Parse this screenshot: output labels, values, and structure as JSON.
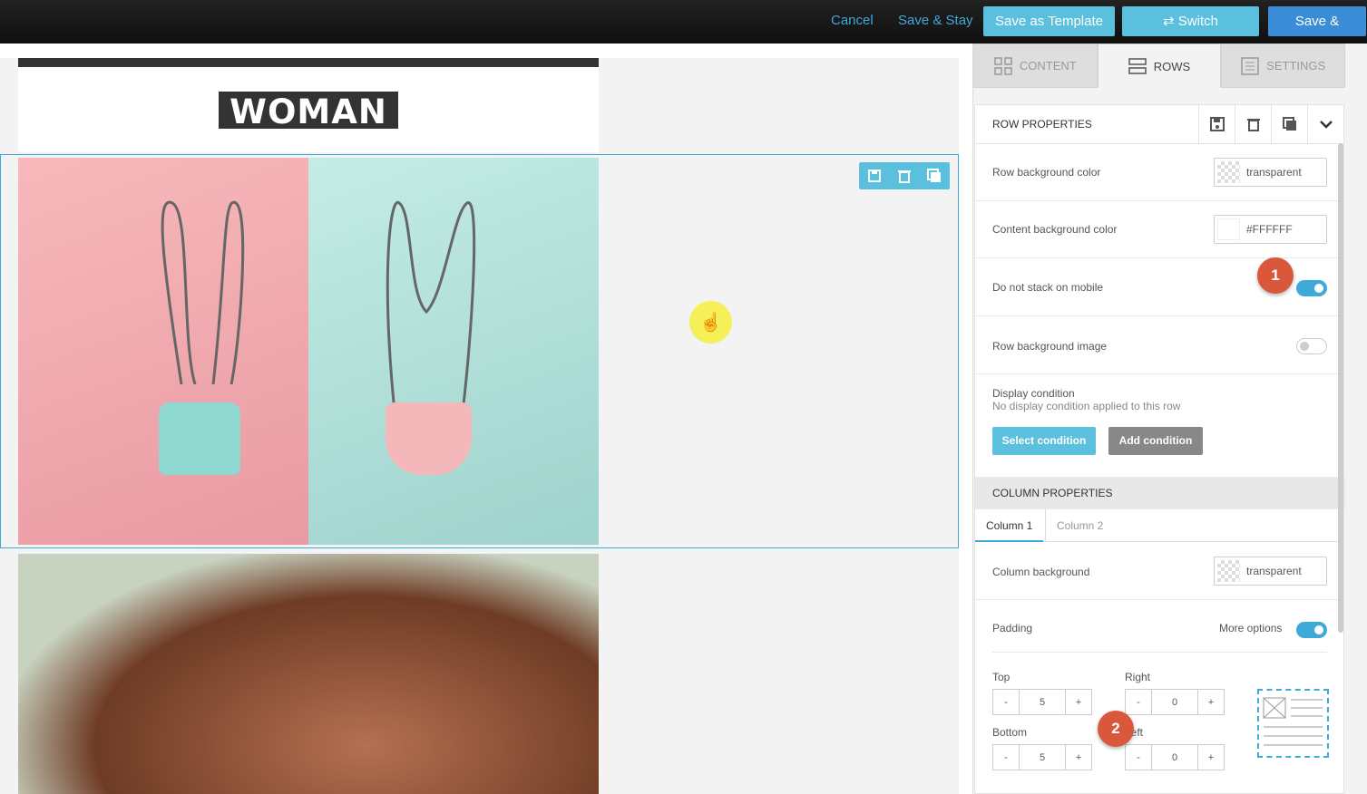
{
  "topbar": {
    "cancel": "Cancel",
    "save_stay": "Save & Stay",
    "save_template": "Save as Template",
    "switch_template": "Switch Template",
    "save_close": "Save & Close"
  },
  "canvas": {
    "logo_text": "WOMAN"
  },
  "sidebar": {
    "tabs": [
      {
        "label": "CONTENT",
        "icon": "grid-icon"
      },
      {
        "label": "ROWS",
        "icon": "rows-icon",
        "active": true
      },
      {
        "label": "SETTINGS",
        "icon": "settings-list-icon"
      }
    ],
    "row_properties": {
      "title": "ROW PROPERTIES",
      "row_bg_label": "Row background color",
      "row_bg_value": "transparent",
      "content_bg_label": "Content background color",
      "content_bg_value": "#FFFFFF",
      "no_stack_label": "Do not stack on mobile",
      "row_bg_image_label": "Row background image",
      "display_condition_label": "Display condition",
      "display_condition_note": "No display condition applied to this row",
      "select_condition": "Select condition",
      "add_condition": "Add condition"
    },
    "column_properties": {
      "title": "COLUMN PROPERTIES",
      "tabs": [
        "Column 1",
        "Column 2"
      ],
      "column_bg_label": "Column background",
      "column_bg_value": "transparent",
      "padding_label": "Padding",
      "more_options": "More options",
      "top_label": "Top",
      "top_value": "5",
      "right_label": "Right",
      "right_value": "0",
      "bottom_label": "Bottom",
      "bottom_value": "5",
      "left_label": "Left",
      "left_value": "0",
      "minus": "-",
      "plus": "+"
    }
  },
  "badges": {
    "one": "1",
    "two": "2"
  },
  "colors": {
    "accent": "#3fa9d9",
    "button_light": "#5bc0de",
    "button_dark": "#3a8dd6",
    "badge": "#d9583c"
  }
}
